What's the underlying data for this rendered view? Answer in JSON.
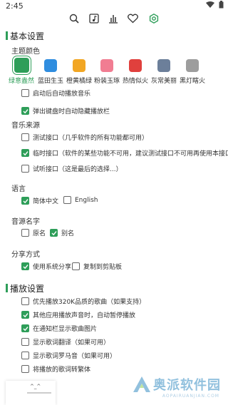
{
  "status_bar": {
    "time": "2:45"
  },
  "toolbar": {
    "icons": [
      "search-icon",
      "music-note-icon",
      "chart-icon",
      "heart-icon",
      "settings-icon"
    ],
    "active_color": "#2e9e59"
  },
  "basic": {
    "title": "基本设置",
    "theme_label": "主题颜色",
    "themes": [
      {
        "name": "绿意盎然",
        "color": "#2e9e59",
        "selected": true
      },
      {
        "name": "蓝田生玉",
        "color": "#2f8ddf",
        "selected": false
      },
      {
        "name": "橙黄橘绿",
        "color": "#f2a623",
        "selected": false
      },
      {
        "name": "粉装玉琢",
        "color": "#f17d92",
        "selected": false
      },
      {
        "name": "热情似火",
        "color": "#e0403d",
        "selected": false
      },
      {
        "name": "灰常美丽",
        "color": "#6c7f9a",
        "selected": false
      },
      {
        "name": "黑灯瞎火",
        "color": "#9d9d9d",
        "selected": false
      }
    ],
    "options": [
      {
        "label": "启动后自动播放音乐",
        "checked": false
      },
      {
        "label": "弹出键盘时自动隐藏播放栏",
        "checked": true
      }
    ],
    "source_label": "音乐来源",
    "sources": [
      {
        "label": "测试接口（几乎软件的所有功能都可用）",
        "checked": false
      },
      {
        "label": "临时接口（软件的某些功能不可用，建议测试接口不可用再使用本接口）",
        "checked": true
      },
      {
        "label": "试听接口（这是最后的选择...）",
        "checked": false
      }
    ],
    "language_label": "语言",
    "languages": [
      {
        "label": "简体中文",
        "checked": true
      },
      {
        "label": "English",
        "checked": false
      }
    ],
    "source_name_label": "音源名字",
    "source_names": [
      {
        "label": "原名",
        "checked": false
      },
      {
        "label": "别名",
        "checked": true
      }
    ],
    "share_label": "分享方式",
    "shares": [
      {
        "label": "使用系统分享",
        "checked": true
      },
      {
        "label": "复制到剪贴板",
        "checked": false
      }
    ]
  },
  "playback": {
    "title": "播放设置",
    "options": [
      {
        "label": "优先播放320K品质的歌曲（如果支持）",
        "checked": false
      },
      {
        "label": "其他应用播放声音时，自动暂停播放",
        "checked": true
      },
      {
        "label": "在通知栏显示歌曲图片",
        "checked": true
      },
      {
        "label": "显示歌词翻译（如果可用）",
        "checked": false
      },
      {
        "label": "显示歌词罗马音（如果可用）",
        "checked": false
      },
      {
        "label": "将播放的歌词转繁体",
        "checked": false
      }
    ]
  },
  "player": {
    "text": "^_^"
  },
  "watermark": {
    "text": "奥派软件园",
    "sub": "AOPAIRUANJIAN.COM"
  }
}
